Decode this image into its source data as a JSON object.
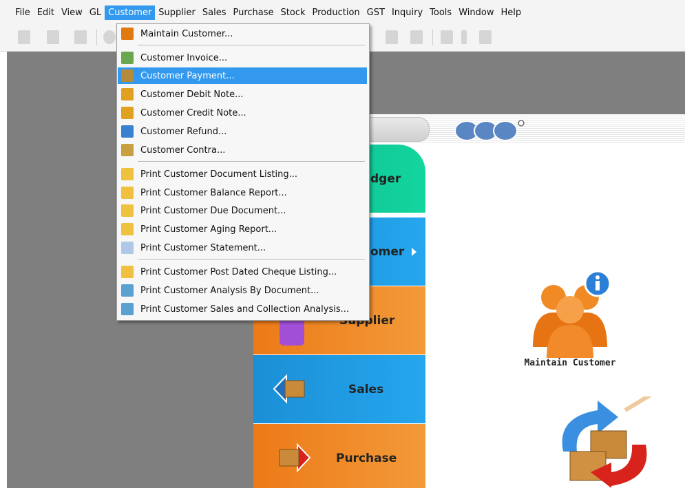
{
  "menubar": {
    "items": [
      {
        "label": "File"
      },
      {
        "label": "Edit"
      },
      {
        "label": "View"
      },
      {
        "label": "GL"
      },
      {
        "label": "Customer",
        "active": true
      },
      {
        "label": "Supplier"
      },
      {
        "label": "Sales"
      },
      {
        "label": "Purchase"
      },
      {
        "label": "Stock"
      },
      {
        "label": "Production"
      },
      {
        "label": "GST"
      },
      {
        "label": "Inquiry"
      },
      {
        "label": "Tools"
      },
      {
        "label": "Window"
      },
      {
        "label": "Help"
      }
    ]
  },
  "dropdown": {
    "items": [
      {
        "label": "Maintain Customer...",
        "icon": "users-icon",
        "color": "#e07a10"
      },
      {
        "label": "Customer Invoice...",
        "icon": "invoice-icon",
        "color": "#6aa84f"
      },
      {
        "label": "Customer Payment...",
        "icon": "money-bag-icon",
        "color": "#b58a3a"
      },
      {
        "label": "Customer Debit Note...",
        "icon": "pencil-note-icon",
        "color": "#e0a020"
      },
      {
        "label": "Customer Credit Note...",
        "icon": "pencil-note-icon",
        "color": "#e0a020"
      },
      {
        "label": "Customer Refund...",
        "icon": "refund-icon",
        "color": "#3a80d0"
      },
      {
        "label": "Customer Contra...",
        "icon": "contra-icon",
        "color": "#c8a040"
      },
      {
        "label": "Print Customer Document Listing...",
        "icon": "printer-icon",
        "color": "#f0c040"
      },
      {
        "label": "Print Customer Balance Report...",
        "icon": "printer-icon",
        "color": "#f0c040"
      },
      {
        "label": "Print Customer Due Document...",
        "icon": "printer-icon",
        "color": "#f0c040"
      },
      {
        "label": "Print Customer Aging Report...",
        "icon": "printer-icon",
        "color": "#f0c040"
      },
      {
        "label": "Print Customer Statement...",
        "icon": "envelope-icon",
        "color": "#b0c8e8"
      },
      {
        "label": "Print Customer Post Dated Cheque Listing...",
        "icon": "printer-icon",
        "color": "#f0c040"
      },
      {
        "label": "Print Customer Analysis By Document...",
        "icon": "chart-icon",
        "color": "#5aa0d0"
      },
      {
        "label": "Print Customer Sales and Collection Analysis...",
        "icon": "chart-icon",
        "color": "#5aa0d0"
      }
    ]
  },
  "side_panel": {
    "gl_label": "dger",
    "customer_label": "omer",
    "supplier_label": "Supplier",
    "sales_label": "Sales",
    "purchase_label": "Purchase"
  },
  "content": {
    "maintain_customer_label": "Maintain Customer"
  },
  "colors": {
    "accent": "#3399ee",
    "gl": "#13d69e",
    "customer": "#25a6ee",
    "supplier": "#f39a3a"
  }
}
